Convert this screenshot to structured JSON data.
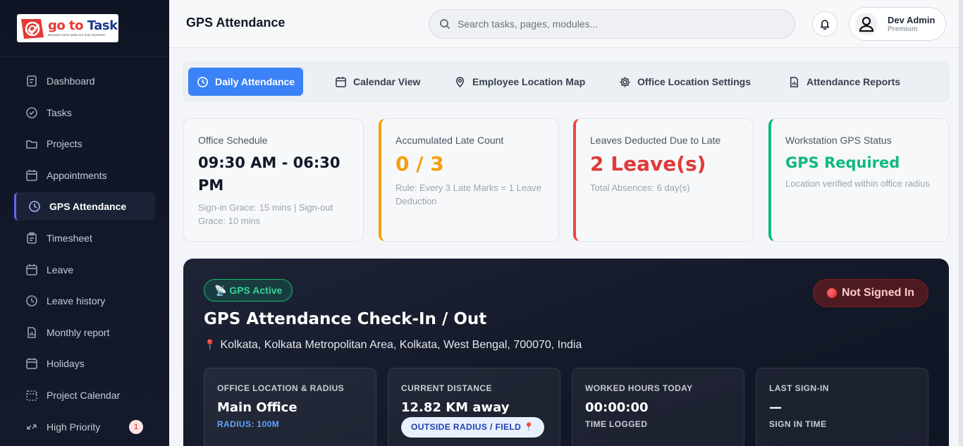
{
  "logo": {
    "title_go": "go to",
    "title_task": "Task",
    "tagline": "Because some tasks are truly important"
  },
  "header": {
    "page_title": "GPS Attendance",
    "search_placeholder": "Search tasks, pages, modules...",
    "user_name": "Dev Admin",
    "user_role": "Premium"
  },
  "sidebar": {
    "items": [
      {
        "label": "Dashboard",
        "icon": "document-icon",
        "active": false
      },
      {
        "label": "Tasks",
        "icon": "check-circle-icon",
        "active": false
      },
      {
        "label": "Projects",
        "icon": "folder-icon",
        "active": false
      },
      {
        "label": "Appointments",
        "icon": "calendar-icon",
        "active": false
      },
      {
        "label": "GPS Attendance",
        "icon": "clock-icon",
        "active": true
      },
      {
        "label": "Timesheet",
        "icon": "clipboard-icon",
        "active": false
      },
      {
        "label": "Leave",
        "icon": "calendar-icon",
        "active": false
      },
      {
        "label": "Leave history",
        "icon": "clock-icon",
        "active": false
      },
      {
        "label": "Monthly report",
        "icon": "report-icon",
        "active": false
      },
      {
        "label": "Holidays",
        "icon": "calendar-icon",
        "active": false
      },
      {
        "label": "Project Calendar",
        "icon": "calendar-dashed-icon",
        "active": false
      },
      {
        "label": "High Priority",
        "icon": "arrows-icon",
        "active": false,
        "badge": "1"
      }
    ]
  },
  "tabs": [
    {
      "label": "Daily Attendance",
      "icon": "clock-icon",
      "active": true
    },
    {
      "label": "Calendar View",
      "icon": "calendar-icon",
      "active": false
    },
    {
      "label": "Employee Location Map",
      "icon": "map-pin-icon",
      "active": false
    },
    {
      "label": "Office Location Settings",
      "icon": "gear-icon",
      "active": false
    },
    {
      "label": "Attendance Reports",
      "icon": "report-icon",
      "active": false
    }
  ],
  "cards": {
    "schedule": {
      "label": "Office Schedule",
      "value": "09:30 AM - 06:30 PM",
      "sub": "Sign-in Grace: 15 mins | Sign-out Grace: 10 mins"
    },
    "late": {
      "label": "Accumulated Late Count",
      "value": "0 / 3",
      "sub": "Rule: Every 3 Late Marks = 1 Leave Deduction"
    },
    "leaves": {
      "label": "Leaves Deducted Due to Late",
      "value": "2 Leave(s)",
      "sub": "Total Absences: 6 day(s)"
    },
    "gps": {
      "label": "Workstation GPS Status",
      "value": "GPS Required",
      "sub": "Location verified within office radius"
    }
  },
  "colors": {
    "accent": "#3b82f6",
    "orange": "#f59e0b",
    "red": "#e03a3a",
    "green": "#10b981"
  },
  "gps_panel": {
    "status_pill": "📡 GPS Active",
    "signed_status": "Not Signed In",
    "title": "GPS Attendance Check-In / Out",
    "address": "Kolkata, Kolkata Metropolitan Area, Kolkata, West Bengal, 700070, India",
    "office": {
      "label": "OFFICE LOCATION & RADIUS",
      "value": "Main Office",
      "sub": "RADIUS: 100M"
    },
    "distance": {
      "label": "CURRENT DISTANCE",
      "value": "12.82 KM away",
      "chip": "OUTSIDE RADIUS / FIELD 📍"
    },
    "worked": {
      "label": "WORKED HOURS TODAY",
      "value": "00:00:00",
      "sub": "TIME LOGGED"
    },
    "last_signin": {
      "label": "LAST SIGN-IN",
      "value": "—",
      "sub": "SIGN IN TIME"
    }
  }
}
